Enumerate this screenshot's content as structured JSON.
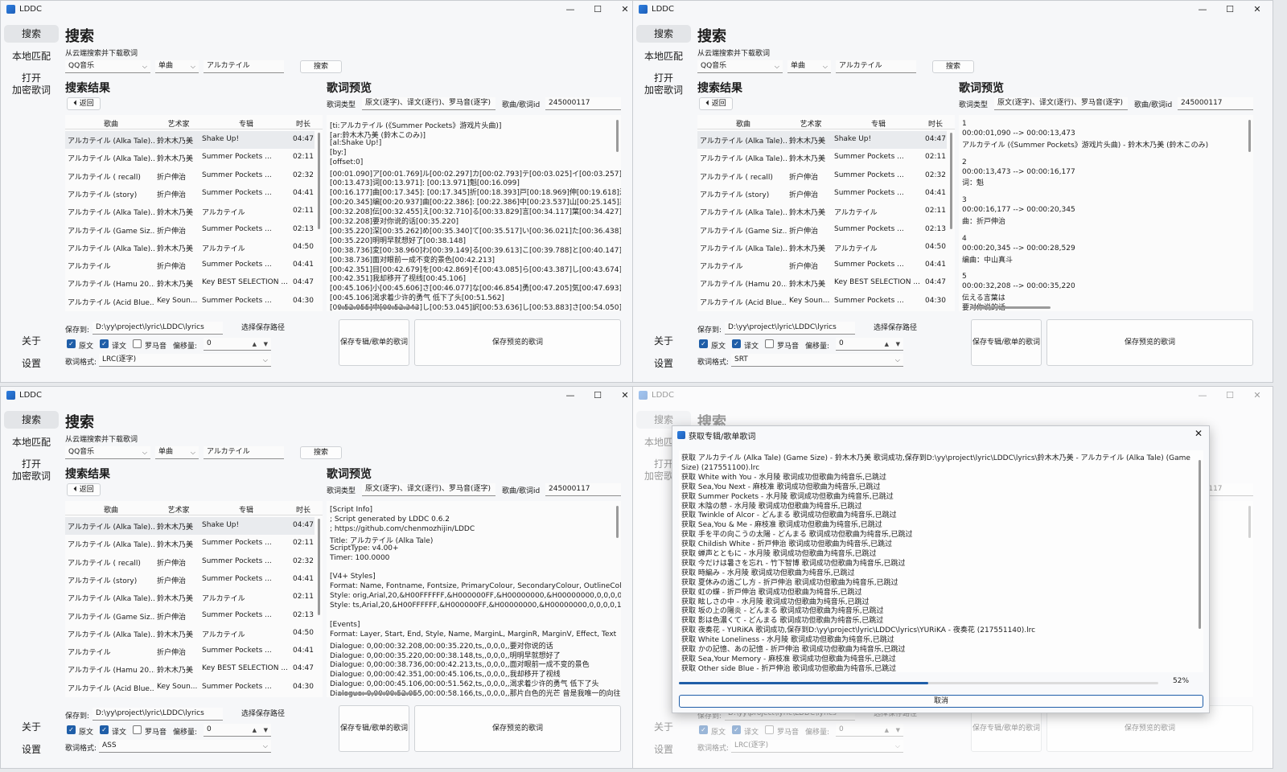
{
  "app_title": "LDDC",
  "window_controls": {
    "minimize": "—",
    "maximize": "☐",
    "close": "✕"
  },
  "nav": {
    "search": "搜索",
    "local": "本地匹配",
    "open1": "打开",
    "open2": "加密歌词",
    "about": "关于",
    "settings": "设置"
  },
  "page_title": "搜索",
  "subtitle": "从云端搜索并下载歌词",
  "source": "QQ音乐",
  "search_type": "单曲",
  "keyword": "アルカテイル",
  "search_button": "搜索",
  "results_title": "搜索结果",
  "back_button": "返回",
  "columns": [
    "歌曲",
    "艺术家",
    "专辑",
    "时长"
  ],
  "rows": [
    [
      "アルカテイル (Alka Tale)...",
      "鈴木木乃美",
      "Shake Up!",
      "04:47"
    ],
    [
      "アルカテイル (Alka Tale)...",
      "鈴木木乃美",
      "Summer Pockets ...",
      "02:11"
    ],
    [
      "アルカテイル ( recall)",
      "折户伸治",
      "Summer Pockets ...",
      "02:32"
    ],
    [
      "アルカテイル (story)",
      "折户伸治",
      "Summer Pockets ...",
      "04:41"
    ],
    [
      "アルカテイル (Alka Tale)...",
      "鈴木木乃美",
      "アルカテイル",
      "02:11"
    ],
    [
      "アルカテイル (Game Siz...",
      "折户伸治",
      "Summer Pockets ...",
      "02:13"
    ],
    [
      "アルカテイル (Alka Tale)...",
      "鈴木木乃美",
      "アルカテイル",
      "04:50"
    ],
    [
      "アルカテイル",
      "折户伸治",
      "Summer Pockets ...",
      "04:41"
    ],
    [
      "アルカテイル (Hamu 20...",
      "鈴木木乃美",
      "Key BEST SELECTION ...",
      "04:47"
    ],
    [
      "アルカテイル (Acid Blue...",
      "Key Soun...",
      "Summer Pockets ...",
      "04:30"
    ]
  ],
  "preview_title": "歌词预览",
  "lyric_type_label": "歌词类型",
  "lyric_type_value": "原文(逐字)、译文(逐行)、罗马音(逐字)",
  "song_id_label": "歌曲/歌词id",
  "song_id": "245000117",
  "save_to_label": "保存到:",
  "save_path": "D:\\yy\\project\\lyric\\LDDC\\lyrics",
  "choose_path_button": "选择保存路径",
  "check_orig": "原文",
  "check_trans": "译文",
  "check_roma": "罗马音",
  "offset_label": "偏移量:",
  "offset_value": "0",
  "format_label": "歌词格式:",
  "save_album_button": "保存专辑/歌单的歌词",
  "save_preview_button": "保存预览的歌词",
  "windows": [
    {
      "format": "LRC(逐字)",
      "preview_lines": [
        "[ti:アルカテイル (《Summer Pockets》游戏片头曲)]",
        "[ar:鈴木木乃美 (鈴木このみ)]",
        "[al:Shake Up!]",
        "[by:]",
        "[offset:0]",
        "[00:01.090]ア[00:01.769]ル[00:02.297]カ[00:02.793]テ[00:03.025]イ[00:03.257]ル[00:",
        "[00:13.473]词[00:13.971]: [00:13.971]魁[00:16.099]",
        "[00:16.177]曲[00:17.345]: [00:17.345]折[00:18.393]戸[00:18.969]伸[00:19.618]治[00:",
        "[00:20.345]编[00:20.937]曲[00:22.386]: [00:22.386]中[00:23.537]山[00:25.145]真[00:",
        "[00:32.208]伝[00:32.455]え[00:32.710]る[00:33.829]言[00:34.117]葉[00:34.427]は[00:",
        "[00:32.208]要对你说的话[00:35.220]",
        "[00:35.220]深[00:35.262]め[00:35.340]て[00:35.517]い[00:36.021]た[00:36.438]は[00:",
        "[00:35.220]明明早就想好了[00:38.148]",
        "[00:38.736]変[00:38.960]わ[00:39.149]る[00:39.613]こ[00:39.788]と[00:40.147]の[00:",
        "[00:38.736]面对眼前一成不变的景色[00:42.213]",
        "[00:42.351]目[00:42.679]を[00:42.869]そ[00:43.085]ら[00:43.387]し[00:43.674]て[00:",
        "[00:42.351]我却移开了视线[00:45.106]",
        "[00:45.106]小[00:45.606]さ[00:46.077]な[00:46.854]勇[00:47.205]気[00:47.693]が[00:",
        "[00:45.106]渴求着少许的勇气 低下了头[00:51.562]",
        "[00:52.055]中[00:52.343]し[00:53.045]訳[00:53.636]し[00:53.883]さ[00:54.050]だ[00:"
      ]
    },
    {
      "format": "SRT",
      "preview_lines": [
        "1",
        "00:00:01,090 --> 00:00:13,473",
        "アルカテイル (《Summer Pockets》游戏片头曲) - 鈴木木乃美 (鈴木このみ)",
        "",
        "2",
        "00:00:13,473 --> 00:00:16,177",
        "词：魁",
        "",
        "3",
        "00:00:16,177 --> 00:00:20,345",
        "曲：折戸伸治",
        "",
        "4",
        "00:00:20,345 --> 00:00:28,529",
        "编曲：中山真斗",
        "",
        "5",
        "00:00:32,208 --> 00:00:35,220",
        "伝える言葉は",
        "要对你说的话"
      ]
    },
    {
      "format": "ASS",
      "preview_lines": [
        "[Script Info]",
        "; Script generated by LDDC 0.6.2",
        "; https://github.com/chenmozhijin/LDDC",
        "Title: アルカテイル (Alka Tale)",
        "ScriptType: v4.00+",
        "Timer: 100.0000",
        "",
        "[V4+ Styles]",
        "Format: Name, Fontname, Fontsize, PrimaryColour, SecondaryColour, OutlineColou",
        "Style: orig,Arial,20,&H00FFFFFF,&H000000FF,&H00000000,&H00000000,0,0,0,0,100,",
        "Style: ts,Arial,20,&H00FFFFFF,&H000000FF,&H00000000,&H00000000,0,0,0,0,100,1(",
        "",
        "[Events]",
        "Format: Layer, Start, End, Style, Name, MarginL, MarginR, MarginV, Effect, Text",
        "Dialogue: 0,00:00:32.208,00:00:35.220,ts,,0,0,0,,要对你说的话",
        "Dialogue: 0,00:00:35.220,00:00:38.148,ts,,0,0,0,,明明早就想好了",
        "Dialogue: 0,00:00:38.736,00:00:42.213,ts,,0,0,0,,面对眼前一成不变的景色",
        "Dialogue: 0,00:00:42.351,00:00:45.106,ts,,0,0,0,,我却移开了视线",
        "Dialogue: 0,00:00:45.106,00:00:51.562,ts,,0,0,0,,渴求着少许的勇气 低下了头",
        "Dialogue: 0,00:00:52.055,00:00:58.166,ts,,0,0,0,,那片白色的光芒 曾是我唯一的向往"
      ]
    },
    {
      "format": "LRC(逐字)",
      "preview_lines": [
        "",
        "",
        "",
        "",
        "",
        "57]ル[00",
        "",
        "18]治[00",
        "45]真[00",
        "27]は[00",
        "",
        "38]は[00",
        "",
        "47]の[00",
        "",
        "74]て[00",
        "",
        "93]が[00",
        "",
        "50]だ[00"
      ]
    }
  ],
  "dialog": {
    "title": "获取专辑/歌单歌词",
    "close": "✕",
    "progress": 52,
    "progress_text": "52%",
    "cancel": "取消",
    "log": [
      "获取 アルカテイル (Alka Tale) (Game Size) - 鈴木木乃美 歌词成功,保存到D:\\yy\\project\\lyric\\LDDC\\lyrics\\鈴木木乃美 - アルカテイル (Alka Tale) (Game",
      "Size) (217551100).lrc",
      "获取 White with You - 水月陵 歌词成功但歌曲为纯音乐,已跳过",
      "获取 Sea,You Next - 麻枝准 歌词成功但歌曲为纯音乐,已跳过",
      "获取 Summer Pockets - 水月陵 歌词成功但歌曲为纯音乐,已跳过",
      "获取 木陰の憩 - 水月陵 歌词成功但歌曲为纯音乐,已跳过",
      "获取 Twinkle of Alcor - どんまる 歌词成功但歌曲为纯音乐,已跳过",
      "获取 Sea,You & Me - 麻枝准 歌词成功但歌曲为纯音乐,已跳过",
      "获取 手を平の向こうの太陽 - どんまる 歌词成功但歌曲为纯音乐,已跳过",
      "获取 Childish White - 折戸伸治 歌词成功但歌曲为纯音乐,已跳过",
      "获取 蝉声とともに - 水月陵 歌词成功但歌曲为纯音乐,已跳过",
      "获取 今だけは暑さを忘れ - 竹下智博 歌词成功但歌曲为纯音乐,已跳过",
      "获取 時編み - 水月陵 歌词成功但歌曲为纯音乐,已跳过",
      "获取 夏休みの過ごし方 - 折戸伸治 歌词成功但歌曲为纯音乐,已跳过",
      "获取 虹の蝶 - 折戸伸治 歌词成功但歌曲为纯音乐,已跳过",
      "获取 眩しさの中 - 水月陵 歌词成功但歌曲为纯音乐,已跳过",
      "获取 坂の上の陽炎 - どんまる 歌词成功但歌曲为纯音乐,已跳过",
      "获取 影は色濃くて - どんまる 歌词成功但歌曲为纯音乐,已跳过",
      "获取 夜奏花 - YURiKA 歌词成功,保存到D:\\yy\\project\\lyric\\LDDC\\lyrics\\YURiKA - 夜奏花 (217551140).lrc",
      "获取 White Loneliness - 水月陵 歌词成功但歌曲为纯音乐,已跳过",
      "获取 かの記憶、あの記憶 - 折戸伸治 歌词成功但歌曲为纯音乐,已跳过",
      "获取 Sea,Your Memory - 麻枝准 歌词成功但歌曲为纯音乐,已跳过",
      "获取 Other side Blue - 折戸伸治 歌词成功但歌曲为纯音乐,已跳过"
    ]
  }
}
